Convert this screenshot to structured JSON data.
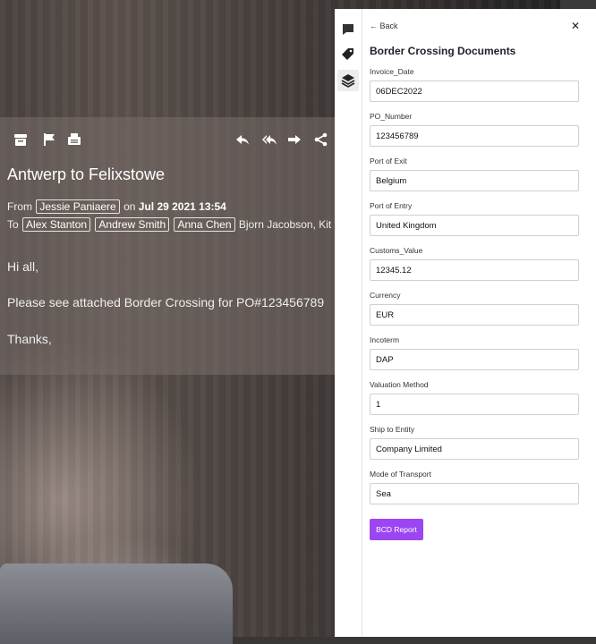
{
  "email": {
    "subject": "Antwerp to Felixstowe",
    "from_label": "From",
    "from_sender": "Jessie Paniaere",
    "on_label": "on",
    "date": "Jul 29 2021 13:54",
    "to_label": "To",
    "to_chips": [
      "Alex Stanton",
      "Andrew Smith",
      "Anna Chen"
    ],
    "to_more": "Bjorn Jacobson,  Kit",
    "body": [
      "Hi all,",
      "Please see attached Border Crossing for PO#123456789",
      "Thanks,"
    ]
  },
  "panel": {
    "back_label": "← Back",
    "close_label": "✕",
    "title": "Border Crossing Documents",
    "fields": [
      {
        "label": "Invoice_Date",
        "value": "06DEC2022"
      },
      {
        "label": "PO_Number",
        "value": "123456789"
      },
      {
        "label": "Port of Exit",
        "value": "Belgium"
      },
      {
        "label": "Port of Entry",
        "value": "United Kingdom"
      },
      {
        "label": "Customs_Value",
        "value": "12345.12"
      },
      {
        "label": "Currency",
        "value": "EUR"
      },
      {
        "label": "Incoterm",
        "value": "DAP"
      },
      {
        "label": "Valuation Method",
        "value": "1"
      },
      {
        "label": "Ship to Entity",
        "value": "Company Limited"
      },
      {
        "label": "Mode of Transport",
        "value": "Sea"
      }
    ],
    "report_button": "BCD Report"
  },
  "colors": {
    "accent": "#9b46f2",
    "panel_bg": "#ffffff",
    "email_overlay": "#786e69"
  },
  "icons": {
    "toolbar": [
      "archive-icon",
      "flag-icon",
      "print-icon",
      "reply-icon",
      "reply-all-icon",
      "forward-icon",
      "share-icon"
    ],
    "rail": [
      "chat-icon",
      "tag-icon",
      "layers-icon"
    ]
  }
}
